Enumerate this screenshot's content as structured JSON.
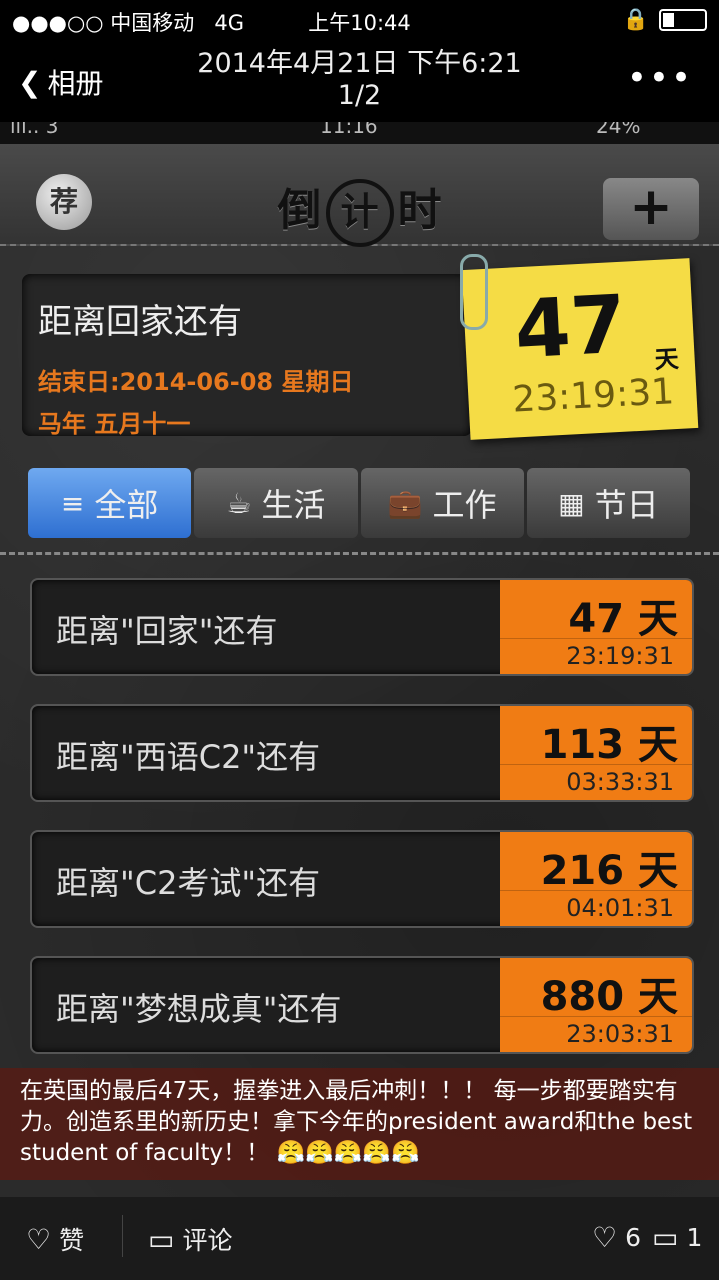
{
  "status_bar": {
    "signal": "●●●○○ 中国移动",
    "network": "4G",
    "time": "上午10:44",
    "battery_level": 0.3
  },
  "nav": {
    "back_label": "相册",
    "title_date": "2014年4月21日 下午6:21",
    "page_indicator": "1/2",
    "more_label": "•••"
  },
  "screenshot": {
    "inner_status": {
      "left": "ııl.. 3",
      "time": "11:16",
      "battery": "24%"
    },
    "header": {
      "recommend_label": "荐",
      "logo_left": "倒",
      "logo_mid": "计",
      "logo_right": "时",
      "add_label": "+"
    },
    "feature": {
      "title": "距离回家还有",
      "end_date": "结束日:2014-06-08 星期日",
      "lunar": "马年 五月十一",
      "days": "47",
      "unit": "天",
      "time": "23:19:31"
    },
    "tabs": [
      {
        "label": "全部",
        "icon": "≡"
      },
      {
        "label": "生活",
        "icon": "☕"
      },
      {
        "label": "工作",
        "icon": "💼"
      },
      {
        "label": "节日",
        "icon": "▦"
      }
    ],
    "items": [
      {
        "title": "距离\"回家\"还有",
        "days": "47 天",
        "time": "23:19:31"
      },
      {
        "title": "距离\"西语C2\"还有",
        "days": "113 天",
        "time": "03:33:31"
      },
      {
        "title": "距离\"C2考试\"还有",
        "days": "216 天",
        "time": "04:01:31"
      },
      {
        "title": "距离\"梦想成真\"还有",
        "days": "880 天",
        "time": "23:03:31"
      }
    ]
  },
  "caption": {
    "text": "在英国的最后47天，握拳进入最后冲刺！！！ 每一步都要踏实有力。创造系里的新历史！拿下今年的president award和the best student of faculty！！",
    "emojis": "😤😤😤😤😤"
  },
  "bottom_bar": {
    "like_label": "赞",
    "comment_label": "评论",
    "like_count": "6",
    "comment_count": "1"
  }
}
